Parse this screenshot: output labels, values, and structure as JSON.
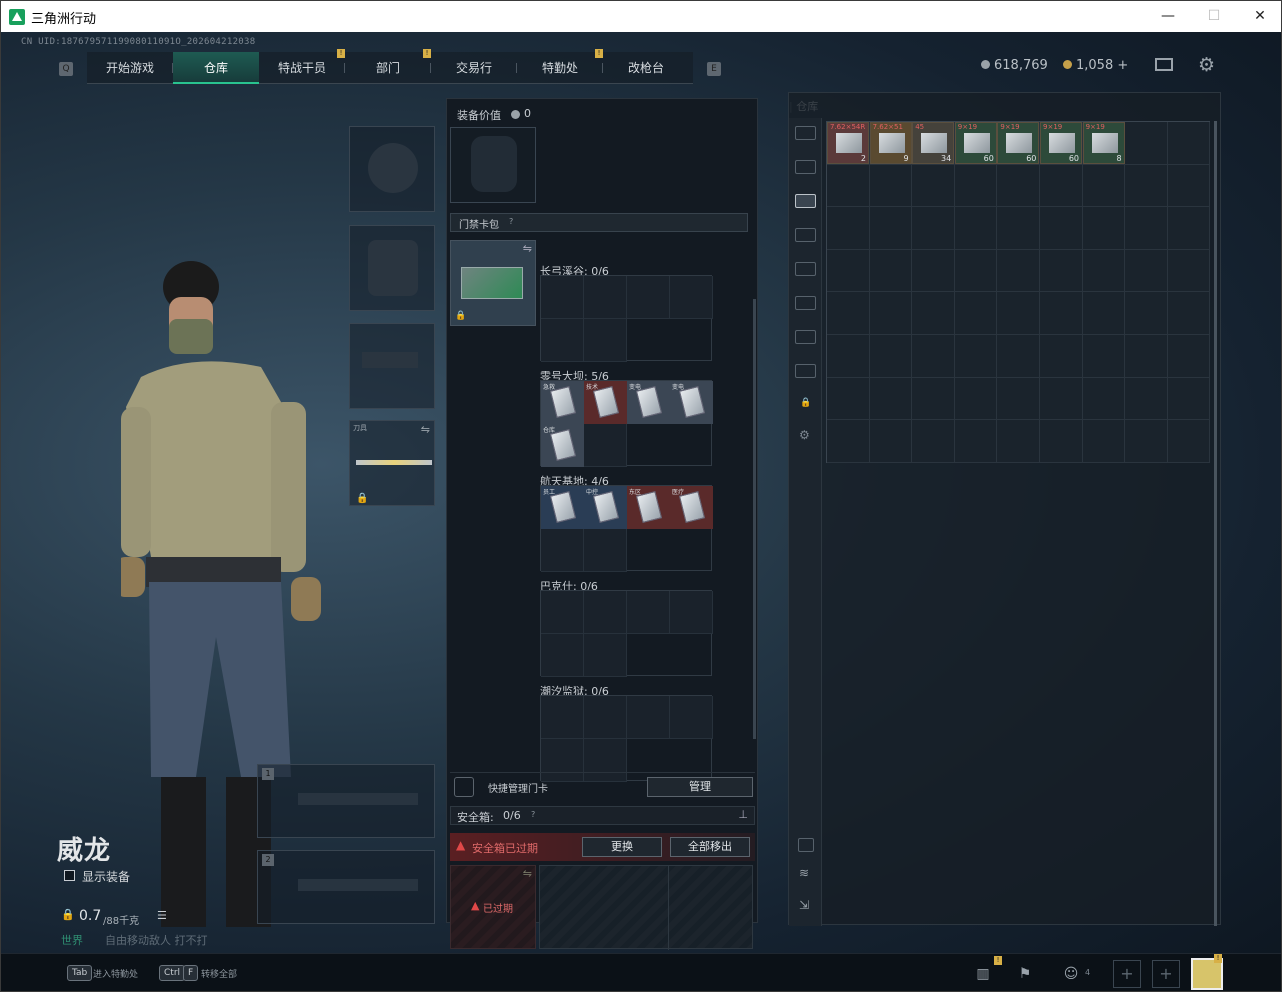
{
  "window": {
    "title": "三角洲行动",
    "minimize": "—",
    "maximize": "☐",
    "close": "✕"
  },
  "uid": "CN UID:18767957119908011091O_202604212038",
  "nav": {
    "left_btn": "Q",
    "right_btn": "E",
    "tabs": [
      {
        "label": "开始游戏",
        "badge": ""
      },
      {
        "label": "仓库",
        "badge": "",
        "active": true
      },
      {
        "label": "特战干员",
        "badge": "!"
      },
      {
        "label": "部门",
        "badge": "!"
      },
      {
        "label": "交易行",
        "badge": ""
      },
      {
        "label": "特勤处",
        "badge": "!"
      },
      {
        "label": "改枪台",
        "badge": ""
      }
    ]
  },
  "currency": {
    "silver": "618,769",
    "gold": "1,058",
    "add": "+"
  },
  "character": {
    "name": "威龙",
    "show_gear_label": "显示装备",
    "weight": "0.7",
    "weight_max": "/88千克",
    "status_text": "世界",
    "status_text2": "自由移动敌人 打不打",
    "knife_label": "刀具",
    "weapon_slot_1": "1",
    "weapon_slot_2": "2"
  },
  "equip": {
    "value_label": "装备价值",
    "value": "0",
    "cardpack_label": "门禁卡包",
    "cardpack_help": "?",
    "sections": [
      {
        "name": "长弓溪谷: 0/6",
        "cards": []
      },
      {
        "name": "零号大坝: 5/6",
        "cards": [
          {
            "label": "急救",
            "color": "gray"
          },
          {
            "label": "技术",
            "color": "red"
          },
          {
            "label": "变电",
            "color": "gray"
          },
          {
            "label": "变电",
            "color": "gray"
          },
          {
            "label": "仓库",
            "color": "gray"
          }
        ]
      },
      {
        "name": "航天基地: 4/6",
        "cards": [
          {
            "label": "员工",
            "color": "blue"
          },
          {
            "label": "中控",
            "color": "blue"
          },
          {
            "label": "东区",
            "color": "red"
          },
          {
            "label": "医疗",
            "color": "red"
          }
        ]
      },
      {
        "name": "巴克什: 0/6",
        "cards": []
      },
      {
        "name": "潮汐监狱: 0/6",
        "cards": []
      }
    ],
    "quick_manage": "快捷管理门卡",
    "manage_btn": "管理",
    "safebox_label": "安全箱:",
    "safebox_value": "0/6",
    "safebox_help": "?",
    "safebox_expired": "安全箱已过期",
    "replace_btn": "更换",
    "moveall_btn": "全部移出",
    "expired_tag": "已过期"
  },
  "warehouse": {
    "title": "仓库",
    "items": [
      {
        "tag": "7.62×54R",
        "qty": "2",
        "color": "#5b3a3a"
      },
      {
        "tag": "7.62×51",
        "qty": "9",
        "color": "#5a4a30"
      },
      {
        "tag": "45",
        "qty": "34",
        "color": "#45423b"
      },
      {
        "tag": "9×19",
        "qty": "60",
        "color": "#2d4a3a"
      },
      {
        "tag": "9×19",
        "qty": "60",
        "color": "#2d4a3a"
      },
      {
        "tag": "9×19",
        "qty": "60",
        "color": "#2d4a3a"
      },
      {
        "tag": "9×19",
        "qty": "8",
        "color": "#2d4a3a"
      }
    ]
  },
  "bottom": {
    "tab_key": "Tab",
    "tab_label": "进入特勤处",
    "ctrl_key": "Ctrl",
    "f_key": "F",
    "transfer_label": "转移全部",
    "friends": "4"
  }
}
